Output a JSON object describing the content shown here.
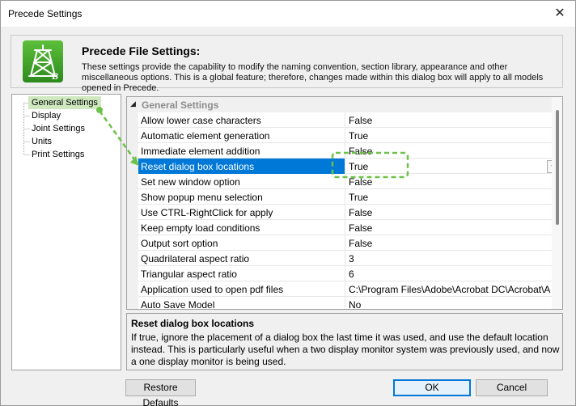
{
  "window": {
    "title": "Precede Settings"
  },
  "header": {
    "title": "Precede File Settings:",
    "description": "These settings provide the capability to modify the naming convention, section library, appearance and other miscellaneous options. This is a global feature; therefore, changes made within this dialog box will apply to all models opened in Precede."
  },
  "tree": {
    "items": [
      "General Settings",
      "Display",
      "Joint Settings",
      "Units",
      "Print Settings"
    ],
    "selected": "General Settings"
  },
  "grid": {
    "section": "General Settings",
    "rows": [
      {
        "name": "Allow lower case characters",
        "value": "False"
      },
      {
        "name": "Automatic element generation",
        "value": "True"
      },
      {
        "name": "Immediate element addition",
        "value": "False"
      },
      {
        "name": "Reset dialog box locations",
        "value": "True"
      },
      {
        "name": "Set new window option",
        "value": "False"
      },
      {
        "name": "Show popup menu selection",
        "value": "True"
      },
      {
        "name": "Use CTRL-RightClick for apply",
        "value": "False"
      },
      {
        "name": "Keep empty load conditions",
        "value": "False"
      },
      {
        "name": "Output sort option",
        "value": "False"
      },
      {
        "name": "Quadrilateral aspect ratio",
        "value": "3"
      },
      {
        "name": "Triangular aspect ratio",
        "value": "6"
      },
      {
        "name": "Application used to open pdf files",
        "value": "C:\\Program Files\\Adobe\\Acrobat DC\\Acrobat\\Acrobat.exe"
      },
      {
        "name": "Auto Save Model",
        "value": "No"
      }
    ],
    "selected_row": "Reset dialog box locations"
  },
  "description": {
    "title": "Reset dialog box locations",
    "text": "If true, ignore the placement of a dialog box the last time it was used, and use the default location instead.  This is particularly useful when a two display monitor system was previously used, and now a one display monitor is being used."
  },
  "buttons": {
    "restore": "Restore Defaults",
    "ok": "OK",
    "cancel": "Cancel"
  },
  "colors": {
    "selection": "#0078d7",
    "annotation": "#6cc24a"
  }
}
